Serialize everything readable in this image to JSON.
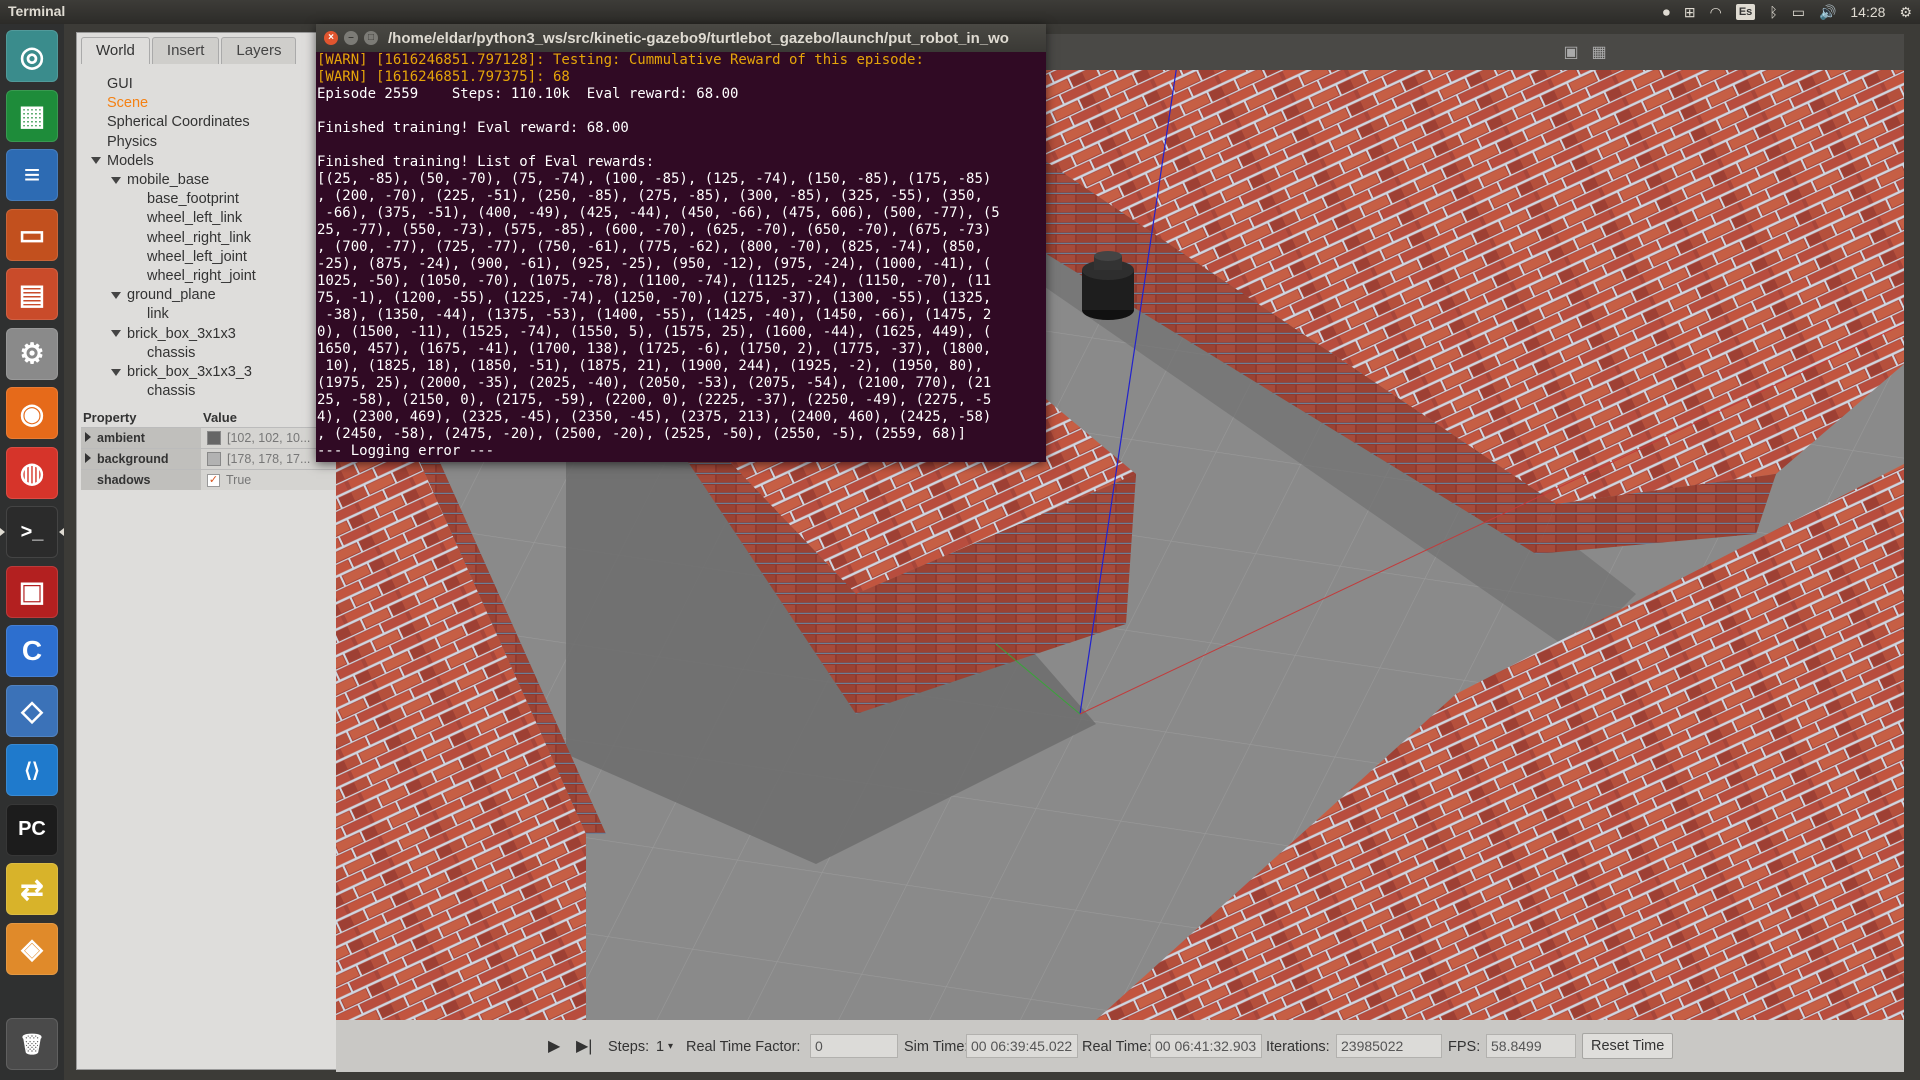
{
  "top_panel": {
    "app_name": "Terminal",
    "keyboard_layout": "Es",
    "clock": "14:28"
  },
  "launcher": {
    "items": [
      {
        "name": "ubuntu-dash",
        "icon": "ubuntu-dash-icon",
        "glyph": "◎",
        "color": "#3a8c8c"
      },
      {
        "name": "libreoffice-calc",
        "icon": "spreadsheet-icon",
        "glyph": "▦",
        "color": "#1e8c3a"
      },
      {
        "name": "libreoffice-writer",
        "icon": "document-icon",
        "glyph": "≡",
        "color": "#2d6bb3"
      },
      {
        "name": "libreoffice-impress",
        "icon": "presentation-icon",
        "glyph": "▭",
        "color": "#c2501e"
      },
      {
        "name": "files",
        "icon": "file-cabinet-icon",
        "glyph": "▤",
        "color": "#c94b2a"
      },
      {
        "name": "settings",
        "icon": "wrench-gear-icon",
        "glyph": "⚙",
        "color": "#8a8a8a"
      },
      {
        "name": "firefox",
        "icon": "firefox-icon",
        "glyph": "◉",
        "color": "#e66a1a"
      },
      {
        "name": "chrome",
        "icon": "chrome-icon",
        "glyph": "◍",
        "color": "#d6342a"
      },
      {
        "name": "terminal",
        "icon": "terminal-icon",
        "glyph": ">_",
        "color": "#2b2b2b"
      },
      {
        "name": "ros-app",
        "icon": "red-window-icon",
        "glyph": "▣",
        "color": "#b32020"
      },
      {
        "name": "code-editor-c",
        "icon": "letter-c-icon",
        "glyph": "C",
        "color": "#2d6fcf"
      },
      {
        "name": "virtualbox",
        "icon": "cube-icon",
        "glyph": "◇",
        "color": "#3b72b8"
      },
      {
        "name": "vscode",
        "icon": "vscode-icon",
        "glyph": "⟨⟩",
        "color": "#1f7acc"
      },
      {
        "name": "pycharm",
        "icon": "pycharm-icon",
        "glyph": "PC",
        "color": "#1c1c1c"
      },
      {
        "name": "yed",
        "icon": "graph-tool-icon",
        "glyph": "⇄",
        "color": "#d8b32a"
      },
      {
        "name": "package-app",
        "icon": "box-icon",
        "glyph": "◈",
        "color": "#e08a2a"
      },
      {
        "name": "trash",
        "icon": "trash-icon",
        "glyph": "🗑",
        "color": "#4a4a4a"
      }
    ]
  },
  "left_panel": {
    "tabs": [
      "World",
      "Insert",
      "Layers"
    ],
    "tree": [
      {
        "label": "GUI",
        "indent": 0,
        "expand": false,
        "selected": false
      },
      {
        "label": "Scene",
        "indent": 0,
        "expand": false,
        "selected": true
      },
      {
        "label": "Spherical Coordinates",
        "indent": 0,
        "expand": false,
        "selected": false
      },
      {
        "label": "Physics",
        "indent": 0,
        "expand": false,
        "selected": false
      },
      {
        "label": "Models",
        "indent": 0,
        "expand": true,
        "selected": false
      },
      {
        "label": "mobile_base",
        "indent": 1,
        "expand": true,
        "selected": false
      },
      {
        "label": "base_footprint",
        "indent": 2,
        "expand": false,
        "selected": false
      },
      {
        "label": "wheel_left_link",
        "indent": 2,
        "expand": false,
        "selected": false
      },
      {
        "label": "wheel_right_link",
        "indent": 2,
        "expand": false,
        "selected": false
      },
      {
        "label": "wheel_left_joint",
        "indent": 2,
        "expand": false,
        "selected": false
      },
      {
        "label": "wheel_right_joint",
        "indent": 2,
        "expand": false,
        "selected": false
      },
      {
        "label": "ground_plane",
        "indent": 1,
        "expand": true,
        "selected": false
      },
      {
        "label": "link",
        "indent": 2,
        "expand": false,
        "selected": false
      },
      {
        "label": "brick_box_3x1x3",
        "indent": 1,
        "expand": true,
        "selected": false
      },
      {
        "label": "chassis",
        "indent": 2,
        "expand": false,
        "selected": false
      },
      {
        "label": "brick_box_3x1x3_3",
        "indent": 1,
        "expand": true,
        "selected": false
      },
      {
        "label": "chassis",
        "indent": 2,
        "expand": false,
        "selected": false
      }
    ],
    "properties": {
      "header_property": "Property",
      "header_value": "Value",
      "rows": [
        {
          "name": "ambient",
          "value": "[102, 102, 10...",
          "swatch": "#666666",
          "expandable": true
        },
        {
          "name": "background",
          "value": "[178, 178, 17...",
          "swatch": "#b2b2b2",
          "expandable": true
        },
        {
          "name": "shadows",
          "value": "True",
          "checkbox": true,
          "expandable": false
        }
      ]
    }
  },
  "bottom_bar": {
    "steps_label": "Steps:",
    "steps_value": "1",
    "rtf_label": "Real Time Factor:",
    "rtf_value": "0",
    "sim_time_label": "Sim Time:",
    "sim_time_value": "00 06:39:45.022",
    "real_time_label": "Real Time:",
    "real_time_value": "00 06:41:32.903",
    "iterations_label": "Iterations:",
    "iterations_value": "23985022",
    "fps_label": "FPS:",
    "fps_value": "58.8499",
    "reset_time_label": "Reset Time"
  },
  "terminal": {
    "title": "/home/eldar/python3_ws/src/kinetic-gazebo9/turtlebot_gazebo/launch/put_robot_in_wo",
    "lines": [
      {
        "text": "[WARN] [1616246851.797128]: Testing: Cummulative Reward of this episode:",
        "warn": true
      },
      {
        "text": "[WARN] [1616246851.797375]: 68",
        "warn": true
      },
      {
        "text": "Episode 2559    Steps: 110.10k  Eval reward: 68.00",
        "warn": false
      },
      {
        "text": "",
        "warn": false
      },
      {
        "text": "Finished training! Eval reward: 68.00",
        "warn": false
      },
      {
        "text": "",
        "warn": false
      },
      {
        "text": "Finished training! List of Eval rewards:",
        "warn": false
      },
      {
        "text": "[(25, -85), (50, -70), (75, -74), (100, -85), (125, -74), (150, -85), (175, -85)",
        "warn": false
      },
      {
        "text": ", (200, -70), (225, -51), (250, -85), (275, -85), (300, -85), (325, -55), (350,",
        "warn": false
      },
      {
        "text": " -66), (375, -51), (400, -49), (425, -44), (450, -66), (475, 606), (500, -77), (5",
        "warn": false
      },
      {
        "text": "25, -77), (550, -73), (575, -85), (600, -70), (625, -70), (650, -70), (675, -73)",
        "warn": false
      },
      {
        "text": ", (700, -77), (725, -77), (750, -61), (775, -62), (800, -70), (825, -74), (850,",
        "warn": false
      },
      {
        "text": "-25), (875, -24), (900, -61), (925, -25), (950, -12), (975, -24), (1000, -41), (",
        "warn": false
      },
      {
        "text": "1025, -50), (1050, -70), (1075, -78), (1100, -74), (1125, -24), (1150, -70), (11",
        "warn": false
      },
      {
        "text": "75, -1), (1200, -55), (1225, -74), (1250, -70), (1275, -37), (1300, -55), (1325,",
        "warn": false
      },
      {
        "text": " -38), (1350, -44), (1375, -53), (1400, -55), (1425, -40), (1450, -66), (1475, 2",
        "warn": false
      },
      {
        "text": "0), (1500, -11), (1525, -74), (1550, 5), (1575, 25), (1600, -44), (1625, 449), (",
        "warn": false
      },
      {
        "text": "1650, 457), (1675, -41), (1700, 138), (1725, -6), (1750, 2), (1775, -37), (1800,",
        "warn": false
      },
      {
        "text": " 10), (1825, 18), (1850, -51), (1875, 21), (1900, 244), (1925, -2), (1950, 80),",
        "warn": false
      },
      {
        "text": "(1975, 25), (2000, -35), (2025, -40), (2050, -53), (2075, -54), (2100, 770), (21",
        "warn": false
      },
      {
        "text": "25, -58), (2150, 0), (2175, -59), (2200, 0), (2225, -37), (2250, -49), (2275, -5",
        "warn": false
      },
      {
        "text": "4), (2300, 469), (2325, -45), (2350, -45), (2375, 213), (2400, 460), (2425, -58)",
        "warn": false
      },
      {
        "text": ", (2450, -58), (2475, -20), (2500, -20), (2525, -50), (2550, -5), (2559, 68)]",
        "warn": false
      },
      {
        "text": "--- Logging error ---",
        "warn": false
      }
    ]
  }
}
